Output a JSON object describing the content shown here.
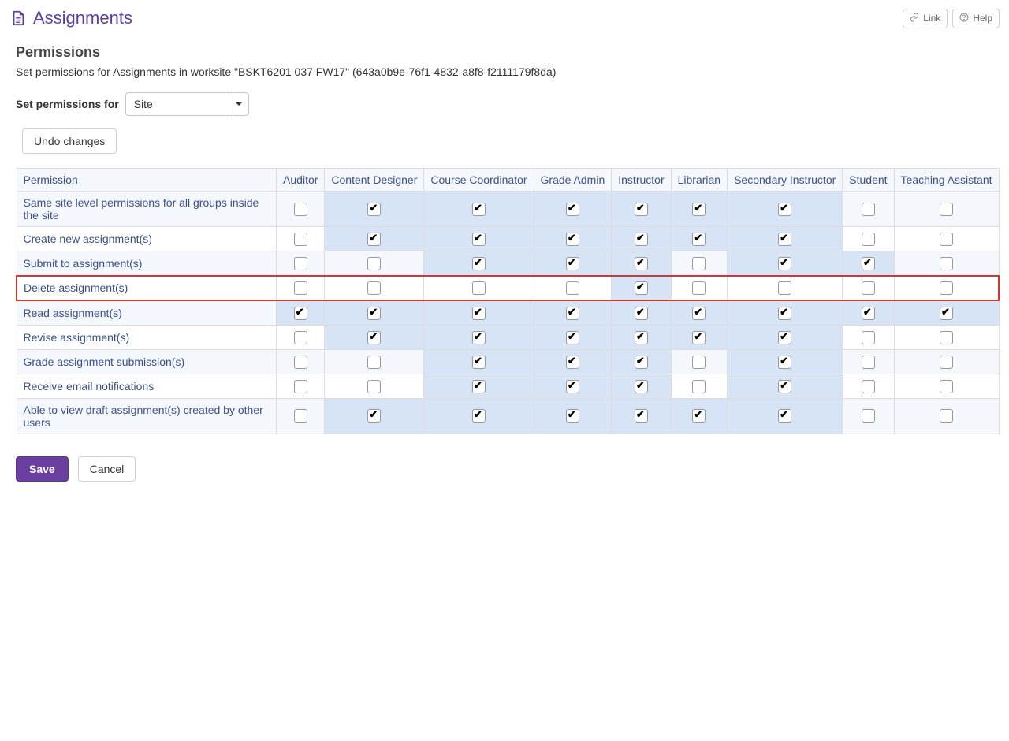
{
  "header": {
    "title": "Assignments",
    "link_label": "Link",
    "help_label": "Help"
  },
  "section": {
    "title": "Permissions",
    "description": "Set permissions for Assignments in worksite \"BSKT6201 037 FW17\" (643a0b9e-76f1-4832-a8f8-f2111179f8da)"
  },
  "form": {
    "scope_label": "Set permissions for",
    "scope_value": "Site",
    "undo_label": "Undo changes"
  },
  "table": {
    "permission_header": "Permission",
    "roles": [
      "Auditor",
      "Content Designer",
      "Course Coordinator",
      "Grade Admin",
      "Instructor",
      "Librarian",
      "Secondary Instructor",
      "Student",
      "Teaching Assistant"
    ],
    "rows": [
      {
        "label": "Same site level permissions for all groups inside the site",
        "checks": [
          false,
          true,
          true,
          true,
          true,
          true,
          true,
          false,
          false
        ],
        "highlight": false
      },
      {
        "label": "Create new assignment(s)",
        "checks": [
          false,
          true,
          true,
          true,
          true,
          true,
          true,
          false,
          false
        ],
        "highlight": false
      },
      {
        "label": "Submit to assignment(s)",
        "checks": [
          false,
          false,
          true,
          true,
          true,
          false,
          true,
          true,
          false
        ],
        "highlight": false
      },
      {
        "label": "Delete assignment(s)",
        "checks": [
          false,
          false,
          false,
          false,
          true,
          false,
          false,
          false,
          false
        ],
        "highlight": true
      },
      {
        "label": "Read assignment(s)",
        "checks": [
          true,
          true,
          true,
          true,
          true,
          true,
          true,
          true,
          true
        ],
        "highlight": false
      },
      {
        "label": "Revise assignment(s)",
        "checks": [
          false,
          true,
          true,
          true,
          true,
          true,
          true,
          false,
          false
        ],
        "highlight": false
      },
      {
        "label": "Grade assignment submission(s)",
        "checks": [
          false,
          false,
          true,
          true,
          true,
          false,
          true,
          false,
          false
        ],
        "highlight": false
      },
      {
        "label": "Receive email notifications",
        "checks": [
          false,
          false,
          true,
          true,
          true,
          false,
          true,
          false,
          false
        ],
        "highlight": false
      },
      {
        "label": "Able to view draft assignment(s) created by other users",
        "checks": [
          false,
          true,
          true,
          true,
          true,
          true,
          true,
          false,
          false
        ],
        "highlight": false
      }
    ]
  },
  "footer": {
    "save": "Save",
    "cancel": "Cancel"
  }
}
